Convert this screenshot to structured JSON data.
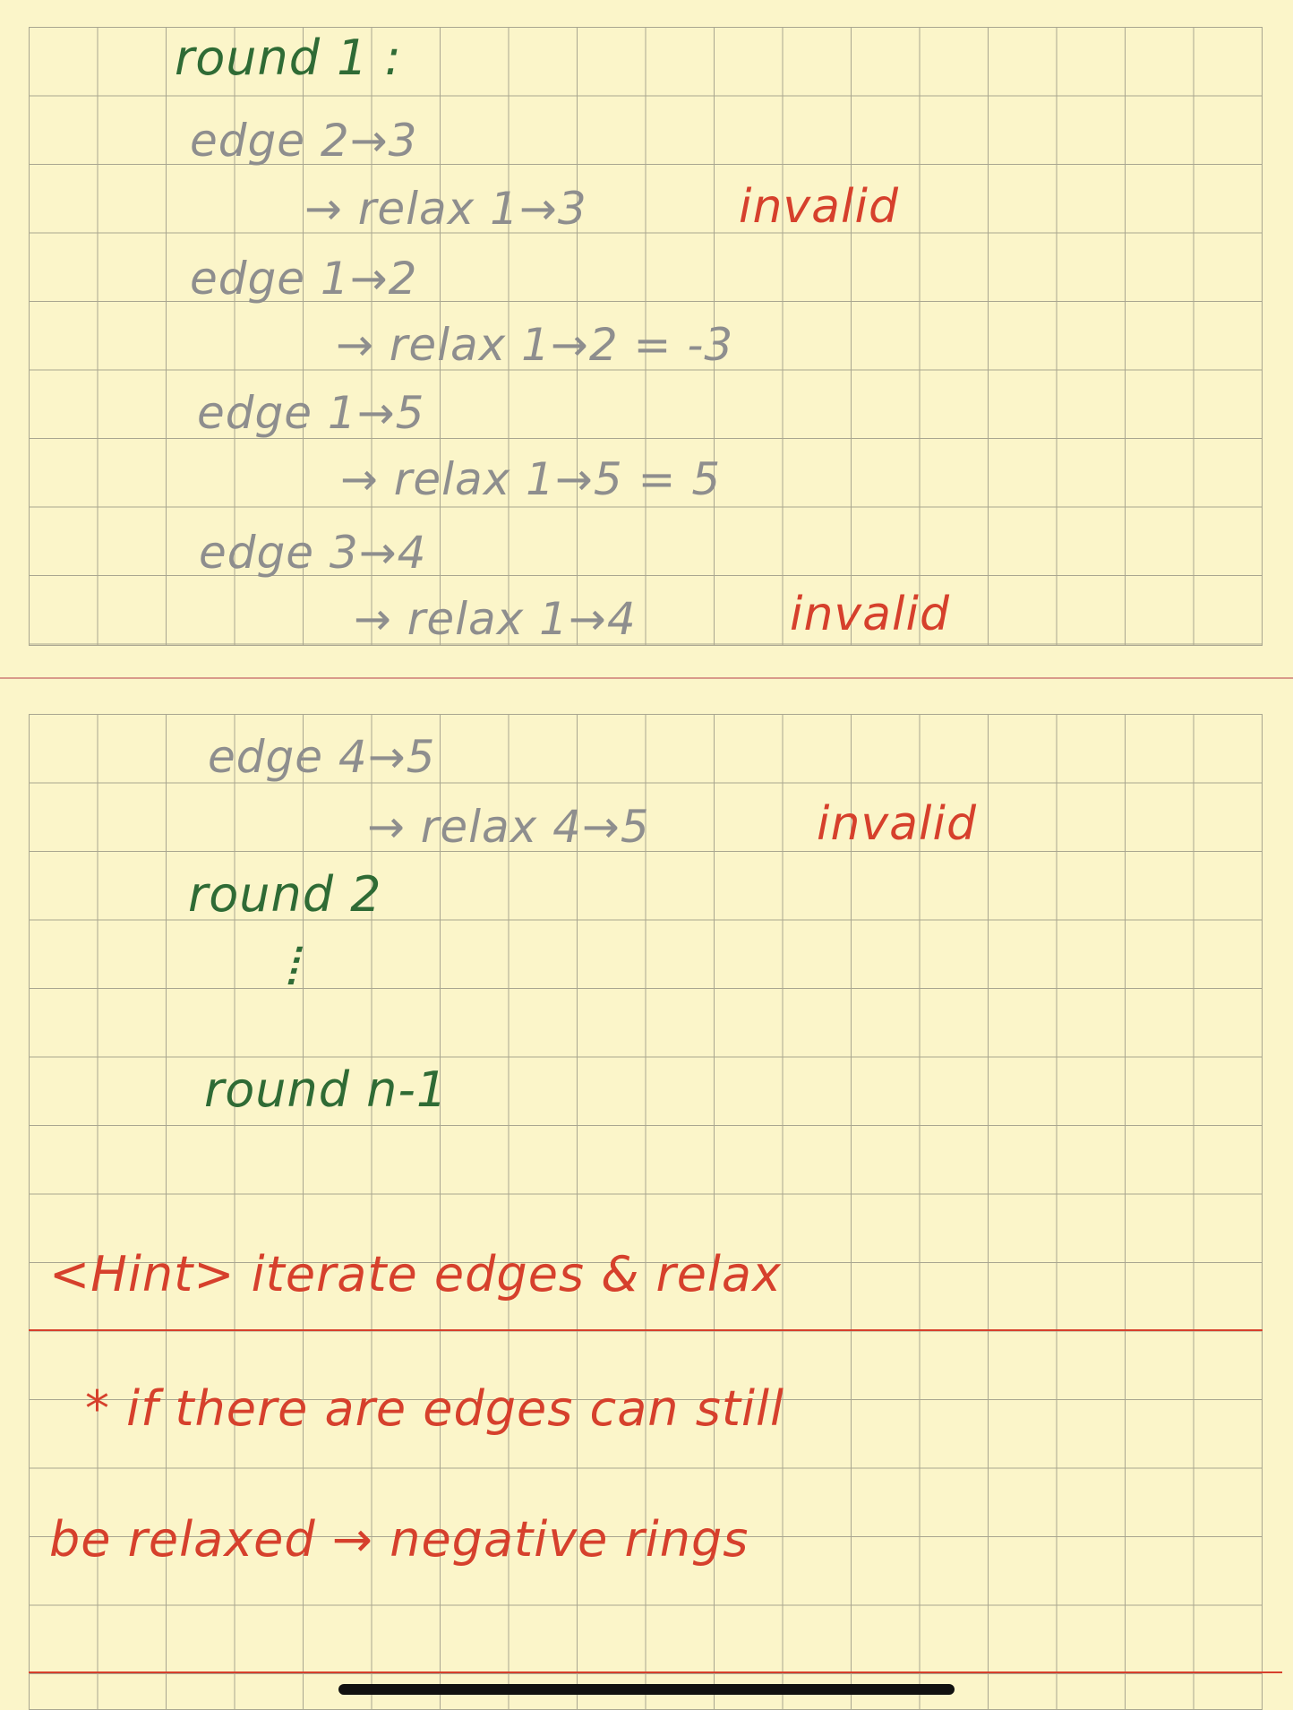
{
  "notes": {
    "round1_heading": "round 1 :",
    "steps": [
      {
        "edge": "edge 2→3",
        "relax": "→ relax 1→3",
        "result": "invalid"
      },
      {
        "edge": "edge 1→2",
        "relax": "→ relax 1→2 = -3",
        "result": ""
      },
      {
        "edge": "edge 1→5",
        "relax": "→ relax 1→5 = 5",
        "result": ""
      },
      {
        "edge": "edge 3→4",
        "relax": "→ relax 1→4",
        "result": "invalid"
      },
      {
        "edge": "edge 4→5",
        "relax": "→ relax 4→5",
        "result": "invalid"
      }
    ],
    "round2_heading": "round 2",
    "ellipsis": "⦙",
    "round_last_heading": "round n-1",
    "hint": "<Hint> iterate edges & relax",
    "note_line1": "* if there are edges can still",
    "note_line2": "be relaxed → negative rings"
  },
  "colors": {
    "paper": "#fbf5c9",
    "grid": "#a9a690",
    "green_ink": "#2f6b35",
    "gray_ink": "#8e8e8e",
    "red_ink": "#d6402c"
  }
}
